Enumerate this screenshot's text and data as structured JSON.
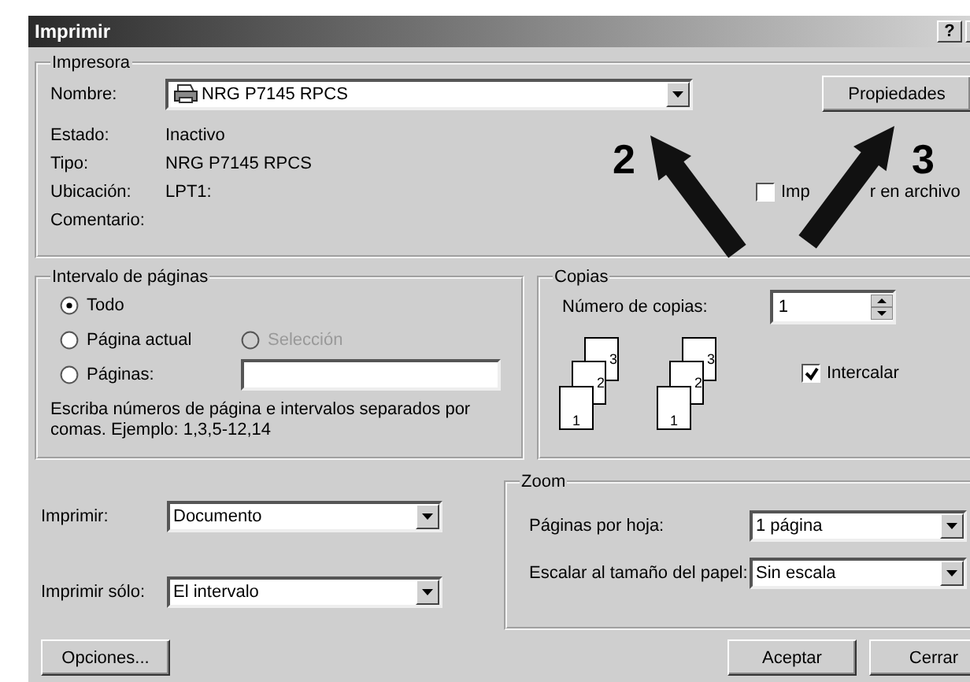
{
  "window": {
    "title": "Imprimir",
    "help_button": "?"
  },
  "printer": {
    "legend": "Impresora",
    "name_label": "Nombre:",
    "name_value": "NRG P7145 RPCS",
    "properties_button": "Propiedades",
    "info": [
      {
        "label": "Estado:",
        "value": "Inactivo"
      },
      {
        "label": "Tipo:",
        "value": "NRG P7145 RPCS"
      },
      {
        "label": "Ubicación:",
        "value": "LPT1:"
      },
      {
        "label": "Comentario:"
      }
    ],
    "print_to_file": {
      "label_parts": [
        "Imp",
        "r en archivo"
      ],
      "checked": false
    }
  },
  "page_range": {
    "legend": "Intervalo de páginas",
    "options": [
      {
        "label": "Todo",
        "selected": true,
        "disabled": false
      },
      {
        "label": "Página actual",
        "selected": false,
        "disabled": false
      },
      {
        "label": "Selección",
        "selected": false,
        "disabled": true
      },
      {
        "label": "Páginas:",
        "selected": false,
        "disabled": false
      }
    ],
    "hint": "Escriba números de página e intervalos separados por comas. Ejemplo: 1,3,5-12,14"
  },
  "copies": {
    "legend": "Copias",
    "count_label": "Número de copias:",
    "count_value": "1",
    "stacks": [
      {
        "pages": [
          "3",
          "2",
          "1"
        ]
      },
      {
        "pages": [
          "3",
          "2",
          "1"
        ]
      }
    ],
    "collate": {
      "label": "Intercalar",
      "checked": true
    }
  },
  "print_what": {
    "label": "Imprimir:",
    "value": "Documento"
  },
  "print_only": {
    "label": "Imprimir sólo:",
    "value": "El intervalo"
  },
  "zoom": {
    "legend": "Zoom",
    "rows": [
      {
        "label": "Páginas por hoja:",
        "value": "1 página"
      },
      {
        "label": "Escalar al tamaño del papel:",
        "value": "Sin escala"
      }
    ]
  },
  "buttons": {
    "options": "Opciones...",
    "ok": "Aceptar",
    "close": "Cerrar"
  },
  "annotations": [
    {
      "label": "2"
    },
    {
      "label": "3"
    }
  ]
}
